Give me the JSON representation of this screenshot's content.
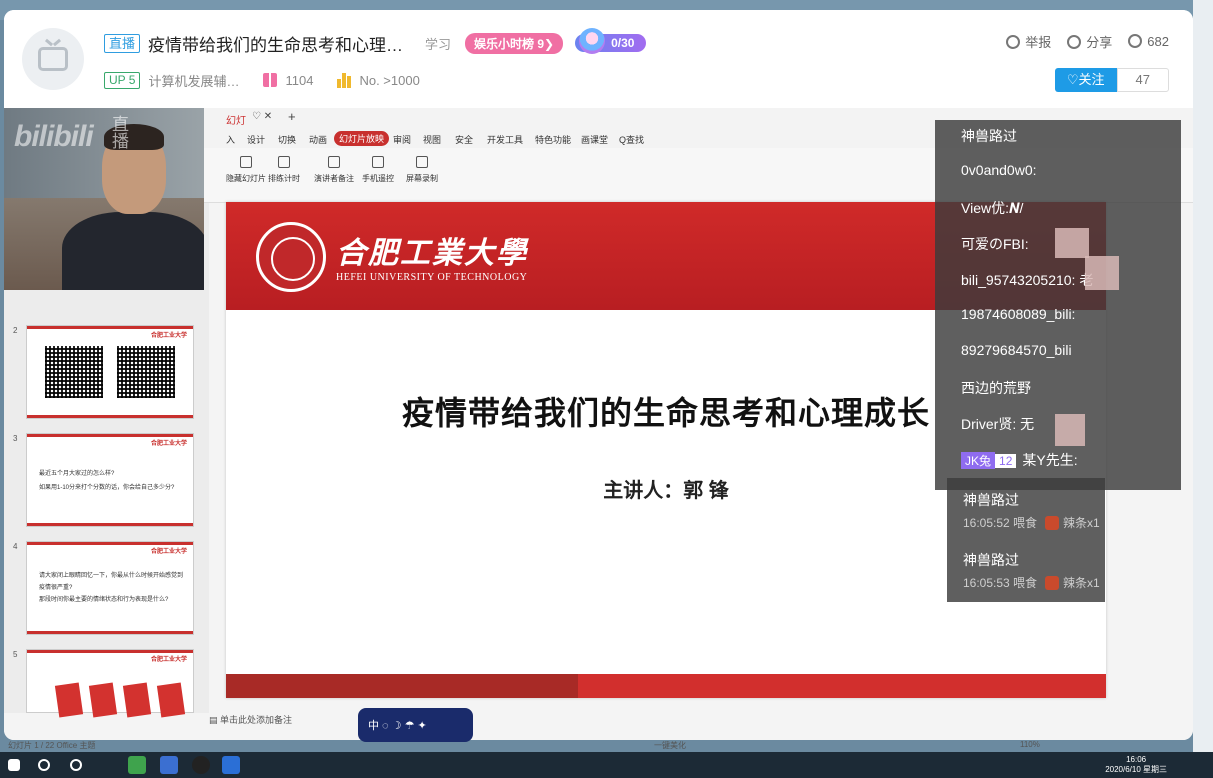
{
  "header": {
    "live_tag": "直播",
    "title": "疫情带给我们的生命思考和心理…",
    "category": "学习",
    "rank": "娱乐小时榜 9❯",
    "fans_count": "0/30",
    "up_level": "UP 5",
    "up_name": "计算机发展辅…",
    "gift_count": "1104",
    "popularity": "No. >1000",
    "report": "举报",
    "share": "分享",
    "viewers": "682",
    "follow": "♡关注",
    "follow_count": "47"
  },
  "webcam": {
    "watermark": "bilibili",
    "watermark2": "直播"
  },
  "ppt": {
    "tab": "幻灯",
    "ribbon_tabs": [
      "入",
      "设计",
      "切换",
      "动画",
      "幻灯片放映",
      "审阅",
      "视图",
      "安全",
      "开发工具",
      "特色功能",
      "画课堂",
      "Q查找"
    ],
    "tools": [
      "隐藏幻灯片",
      "排练计时",
      "演讲者备注",
      "手机遥控",
      "屏幕录制"
    ],
    "thumb_numbers": [
      "2",
      "3",
      "4",
      "5"
    ],
    "thumb3_line1": "最近五个月大家过的怎么样?",
    "thumb3_line2": "如果用1-10分来打个分数的话，你会给自己多少分?",
    "thumb4_line1": "请大家闭上眼睛回忆一下，你最从什么时候开始感觉到",
    "thumb4_line2": "疫情很严重?",
    "thumb4_line3": "那段时间你最主要的情绪状态和行为表现是什么?",
    "thumb_logo": "合肥工业大学",
    "notes_placeholder": "单击此处添加备注",
    "slide_count": "幻灯片 1 / 22",
    "theme": "Office 主题",
    "beautify": "一键美化",
    "zoom": "110%"
  },
  "slide": {
    "university_cn": "合肥工業大學",
    "university_en": "HEFEI UNIVERSITY OF TECHNOLOGY",
    "title": "疫情带给我们的生命思考和心理成长",
    "speaker": "主讲人：郭 锋"
  },
  "chat": {
    "messages": [
      "神兽路过",
      "0v0and0w0:",
      "View优:𝑵/",
      "可爱のFBI:",
      "bili_95743205210: 老",
      "19874608089_bili:",
      "89279684570_bili",
      "西边的荒野",
      "Driver贤: 无",
      "某Y先生:"
    ],
    "badge": "JK兔",
    "badge_level": "12",
    "gift_user_1": "神兽路过",
    "gift_time_1": "16:05:52 喂食",
    "gift_item_1": "辣条x1",
    "gift_user_2": "神兽路过",
    "gift_time_2": "16:05:53 喂食",
    "gift_item_2": "辣条x1"
  },
  "ime": {
    "text": "中 ◌ ☽ ☂ ✦"
  },
  "taskbar": {
    "time": "16:06",
    "date": "2020/6/10 星期三"
  },
  "colors": {
    "accent_blue": "#1e9be6",
    "pink": "#f06fa3",
    "hfut_red": "#c8302e"
  }
}
